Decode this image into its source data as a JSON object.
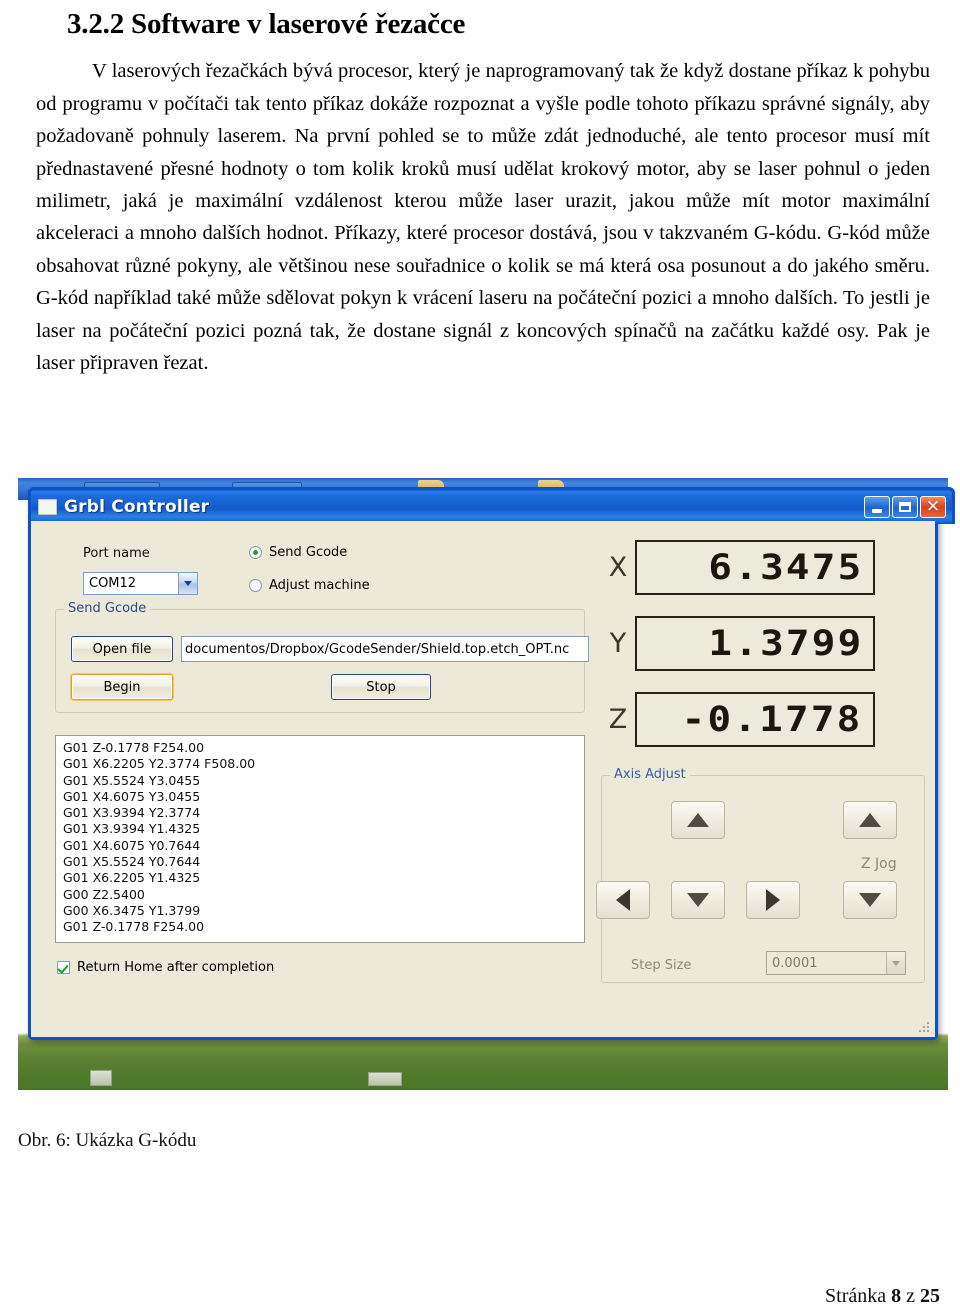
{
  "document": {
    "heading": "3.2.2 Software v laserové řezačce",
    "paragraph": "V laserových řezačkách bývá procesor, který je naprogramovaný tak že když dostane příkaz k pohybu od programu v počítači tak tento příkaz dokáže rozpoznat a vyšle podle tohoto příkazu správné signály, aby požadovaně pohnuly laserem. Na první pohled se to může zdát jednoduché, ale tento procesor musí mít přednastavené přesné hodnoty o tom kolik kroků musí udělat krokový motor, aby se laser pohnul o jeden milimetr, jaká je maximální vzdálenost kterou může laser urazit, jakou může mít motor maximální akceleraci a mnoho dalších hodnot. Příkazy, které procesor dostává, jsou v takzvaném G-kódu. G-kód může obsahovat různé pokyny, ale většinou nese souřadnice o kolik se má která osa posunout a do jakého směru. G-kód například také může sdělovat pokyn k vrácení laseru na počáteční pozici a mnoho dalších. To jestli je laser na počáteční pozici pozná tak, že dostane signál z koncových spínačů na začátku každé osy. Pak je laser připraven řezat.",
    "figure_caption": "Obr. 6: Ukázka G-kódu",
    "footer": {
      "prefix": "Stránka ",
      "page": "8",
      "middle": " z ",
      "total": "25"
    }
  },
  "window": {
    "title": "Grbl Controller",
    "icon": "window-app-icon",
    "buttons": {
      "minimize": "minimize-icon",
      "maximize": "maximize-icon",
      "close": "close-icon"
    },
    "colors": {
      "titlebar": "#1660d1",
      "client": "#ece9d8",
      "border": "#0b52c4",
      "close_button": "#d8431a",
      "default_button_focus": "#e0a12b",
      "radio_selected": "#23a024",
      "checkbox_check": "#17a11a",
      "group_title": "#2b4a8a"
    }
  },
  "form": {
    "port_name_label": "Port name",
    "port_value": "COM12",
    "mode_radios": [
      {
        "label": "Send Gcode",
        "selected": true
      },
      {
        "label": "Adjust machine",
        "selected": false
      }
    ],
    "send_group_title": "Send Gcode",
    "open_file_button": "Open file",
    "file_path": "documentos/Dropbox/GcodeSender/Shield.top.etch_OPT.nc",
    "begin_button": "Begin",
    "stop_button": "Stop",
    "return_home_label": "Return Home after completion",
    "return_home_checked": true
  },
  "gcode_lines": [
    "G01 Z-0.1778 F254.00",
    "G01 X6.2205 Y2.3774 F508.00",
    "G01 X5.5524 Y3.0455",
    "G01 X4.6075 Y3.0455",
    "G01 X3.9394 Y2.3774",
    "G01 X3.9394 Y1.4325",
    "G01 X4.6075 Y0.7644",
    "G01 X5.5524 Y0.7644",
    "G01 X6.2205 Y1.4325",
    "G00 Z2.5400",
    "G00 X6.3475 Y1.3799",
    "G01 Z-0.1778 F254.00"
  ],
  "dro": [
    {
      "axis": "X",
      "value": "6.3475"
    },
    {
      "axis": "Y",
      "value": "1.3799"
    },
    {
      "axis": "Z",
      "value": "-0.1778"
    }
  ],
  "axis_adjust": {
    "title": "Axis Adjust",
    "z_jog_label": "Z Jog",
    "step_size_label": "Step Size",
    "step_size_value": "0.0001",
    "buttons": {
      "y_plus": "arrow-up-icon",
      "y_minus": "arrow-down-icon",
      "x_minus": "arrow-left-icon",
      "x_plus": "arrow-right-icon",
      "z_up": "arrow-up-icon",
      "z_down": "arrow-down-icon"
    },
    "enabled": false
  }
}
